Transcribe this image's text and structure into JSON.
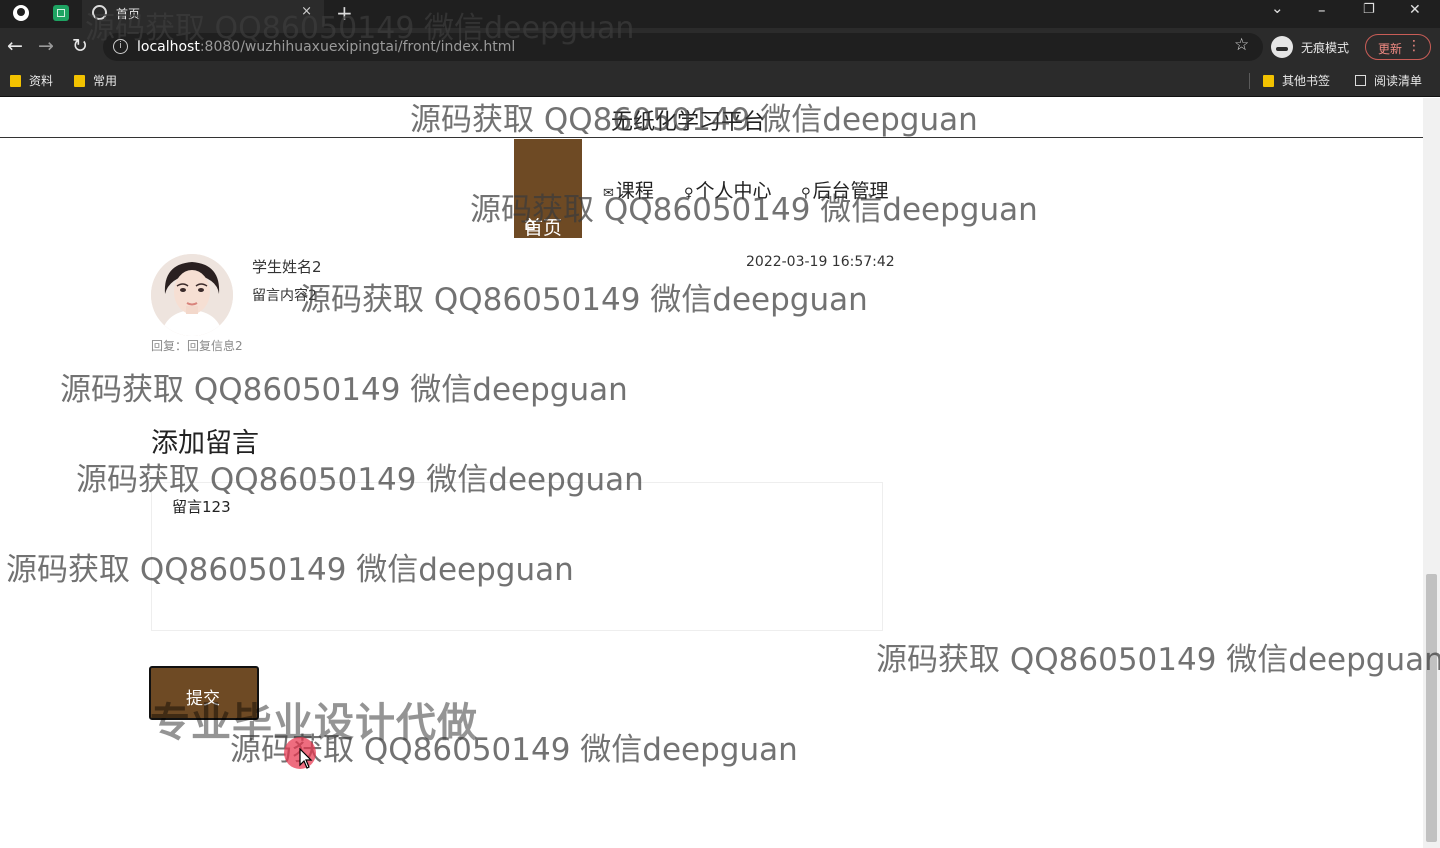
{
  "browser": {
    "tab_title": "首页",
    "tab_close": "×",
    "new_tab": "+",
    "url_host": "localhost",
    "url_rest": ":8080/wuzhihuaxuexipingtai/front/index.html",
    "incognito_label": "无痕模式",
    "update_label": "更新",
    "menu_glyph": "⋮",
    "back_glyph": "←",
    "forward_glyph": "→",
    "reload_glyph": "↻",
    "star_glyph": "☆",
    "win_min": "–",
    "win_max": "❐",
    "win_close": "✕",
    "win_dropdown": "⌄",
    "bookmarks": [
      "资料",
      "常用"
    ],
    "other_bookmarks": "其他书签",
    "reading_list": "阅读清单",
    "colors": {
      "tabbar": "#1f1f1f",
      "toolbar": "#2b2b2b",
      "update_accent": "#f08a83"
    }
  },
  "site": {
    "title": "无纸化学习平台",
    "nav": {
      "home": "首页",
      "courses": "课程",
      "profile": "个人中心",
      "admin": "后台管理"
    },
    "icons": {
      "home": "⌂",
      "courses": "✉",
      "profile": "♀",
      "admin": "⚲"
    },
    "accent_color": "#6e4a24"
  },
  "message": {
    "student_name": "学生姓名2",
    "content": "留言内容2",
    "time": "2022-03-19 16:57:42",
    "reply": "回复：回复信息2"
  },
  "add_message": {
    "title": "添加留言",
    "textarea_value": "留言123",
    "submit_label": "提交"
  },
  "overlay": {
    "watermark": "源码获取 QQ86050149 微信deepguan",
    "promo": "专业毕业设计代做"
  }
}
